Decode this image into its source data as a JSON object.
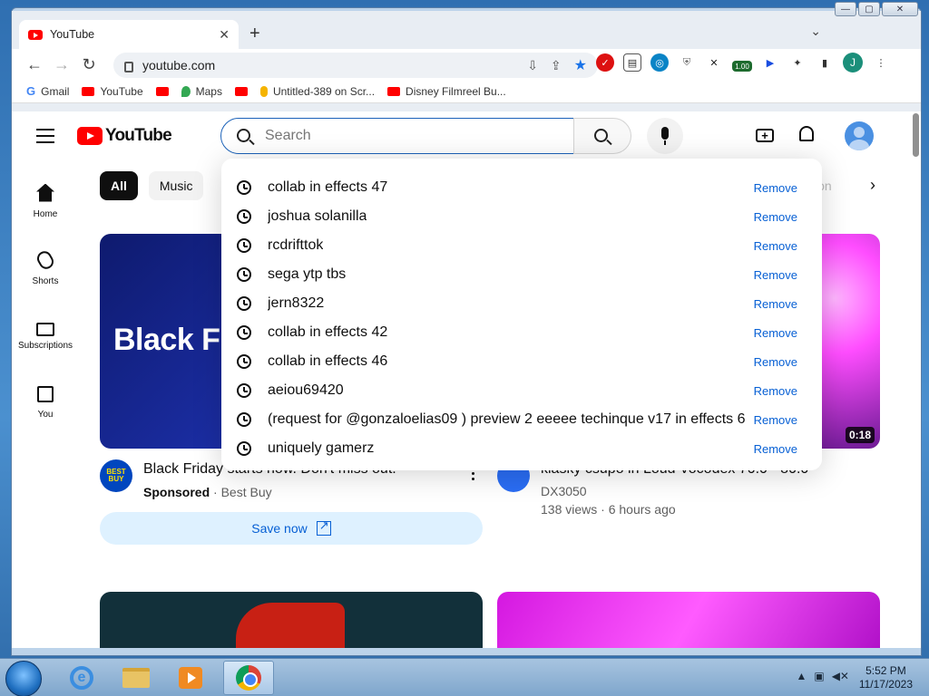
{
  "browser": {
    "tab_title": "YouTube",
    "url": "youtube.com",
    "new_tab_symbol": "+",
    "profile_initial": "J",
    "badge": "1.00",
    "bookmarks": [
      {
        "label": "Gmail",
        "icon": "google-icon"
      },
      {
        "label": "YouTube",
        "icon": "youtube-icon"
      },
      {
        "label": "",
        "icon": "youtube-icon"
      },
      {
        "label": "Maps",
        "icon": "maps-icon"
      },
      {
        "label": "",
        "icon": "youtube-icon"
      },
      {
        "label": "Untitled-389 on Scr...",
        "icon": "scratch-icon"
      },
      {
        "label": "Disney Filmreel Bu...",
        "icon": "youtube-icon"
      }
    ]
  },
  "youtube": {
    "logo_text": "YouTube",
    "search_placeholder": "Search",
    "chips": [
      "All",
      "Music"
    ],
    "chip_partial": "ion",
    "sidebar": [
      {
        "label": "Home",
        "icon": "home-icon"
      },
      {
        "label": "Shorts",
        "icon": "shorts-icon"
      },
      {
        "label": "Subscriptions",
        "icon": "subscriptions-icon"
      },
      {
        "label": "You",
        "icon": "you-icon"
      }
    ],
    "suggestions": [
      "collab in effects 47",
      "joshua solanilla",
      "rcdrifttok",
      "sega ytp tbs",
      "jern8322",
      "collab in effects 42",
      "collab in effects 46",
      "aeiou69420",
      "(request for @gonzaloelias09 ) preview 2 eeeee techinque v17 in effects 6",
      "uniquely gamerz"
    ],
    "remove_label": "Remove",
    "video1": {
      "thumb_text": "Black F",
      "title": "Black Friday starts now. Don't miss out.",
      "sponsored": "Sponsored",
      "channel": "Best Buy",
      "avatar_text": "BEST BUY",
      "cta": "Save now"
    },
    "video2": {
      "duration": "0:18",
      "title": "klasky csupo in Loud Vocodex 70.0 - 80.0",
      "channel": "DX3050",
      "views": "138 views",
      "age": "6 hours ago"
    }
  },
  "taskbar": {
    "time": "5:52 PM",
    "date": "11/17/2023"
  }
}
